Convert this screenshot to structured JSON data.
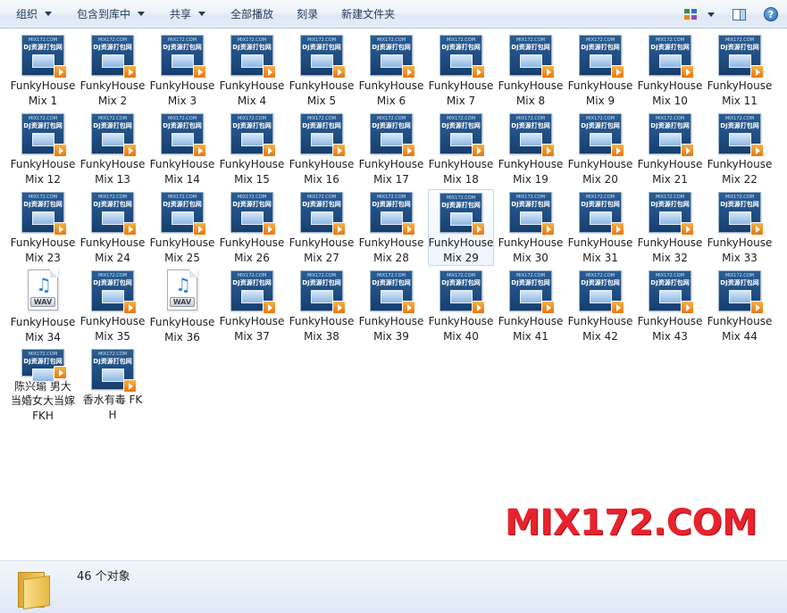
{
  "toolbar": {
    "organize": "组织",
    "include_in_library": "包含到库中",
    "share": "共享",
    "play_all": "全部播放",
    "burn": "刻录",
    "new_folder": "新建文件夹",
    "help": "?"
  },
  "thumbnail": {
    "site": "MIX172.COM",
    "caption": "DJ资源打包网"
  },
  "files": [
    {
      "name": "FunkyHouse Mix 1",
      "type": "video"
    },
    {
      "name": "FunkyHouse Mix 2",
      "type": "video"
    },
    {
      "name": "FunkyHouse Mix 3",
      "type": "video"
    },
    {
      "name": "FunkyHouse Mix 4",
      "type": "video"
    },
    {
      "name": "FunkyHouse Mix 5",
      "type": "video"
    },
    {
      "name": "FunkyHouse Mix 6",
      "type": "video"
    },
    {
      "name": "FunkyHouse Mix 7",
      "type": "video"
    },
    {
      "name": "FunkyHouse Mix 8",
      "type": "video"
    },
    {
      "name": "FunkyHouse Mix 9",
      "type": "video"
    },
    {
      "name": "FunkyHouse Mix 10",
      "type": "video"
    },
    {
      "name": "FunkyHouse Mix 11",
      "type": "video"
    },
    {
      "name": "FunkyHouse Mix 12",
      "type": "video"
    },
    {
      "name": "FunkyHouse Mix 13",
      "type": "video"
    },
    {
      "name": "FunkyHouse Mix 14",
      "type": "video"
    },
    {
      "name": "FunkyHouse Mix 15",
      "type": "video"
    },
    {
      "name": "FunkyHouse Mix 16",
      "type": "video"
    },
    {
      "name": "FunkyHouse Mix 17",
      "type": "video"
    },
    {
      "name": "FunkyHouse Mix 18",
      "type": "video"
    },
    {
      "name": "FunkyHouse Mix 19",
      "type": "video"
    },
    {
      "name": "FunkyHouse Mix 20",
      "type": "video"
    },
    {
      "name": "FunkyHouse Mix 21",
      "type": "video"
    },
    {
      "name": "FunkyHouse Mix 22",
      "type": "video"
    },
    {
      "name": "FunkyHouse Mix 23",
      "type": "video"
    },
    {
      "name": "FunkyHouse Mix 24",
      "type": "video"
    },
    {
      "name": "FunkyHouse Mix 25",
      "type": "video"
    },
    {
      "name": "FunkyHouse Mix 26",
      "type": "video"
    },
    {
      "name": "FunkyHouse Mix 27",
      "type": "video"
    },
    {
      "name": "FunkyHouse Mix 28",
      "type": "video"
    },
    {
      "name": "FunkyHouse Mix 29",
      "type": "video",
      "selected": true
    },
    {
      "name": "FunkyHouse Mix 30",
      "type": "video"
    },
    {
      "name": "FunkyHouse Mix 31",
      "type": "video"
    },
    {
      "name": "FunkyHouse Mix 32",
      "type": "video"
    },
    {
      "name": "FunkyHouse Mix 33",
      "type": "video"
    },
    {
      "name": "FunkyHouse Mix 34",
      "type": "wav"
    },
    {
      "name": "FunkyHouse Mix 35",
      "type": "video"
    },
    {
      "name": "FunkyHouse Mix 36",
      "type": "wav"
    },
    {
      "name": "FunkyHouse Mix 37",
      "type": "video"
    },
    {
      "name": "FunkyHouse Mix 38",
      "type": "video"
    },
    {
      "name": "FunkyHouse Mix 39",
      "type": "video"
    },
    {
      "name": "FunkyHouse Mix 40",
      "type": "video"
    },
    {
      "name": "FunkyHouse Mix 41",
      "type": "video"
    },
    {
      "name": "FunkyHouse Mix 42",
      "type": "video"
    },
    {
      "name": "FunkyHouse Mix 43",
      "type": "video"
    },
    {
      "name": "FunkyHouse Mix 44",
      "type": "video"
    },
    {
      "name": "陈兴瑜 男大当婚女大当嫁 FKH",
      "type": "video"
    },
    {
      "name": "香水有毒 FKH",
      "type": "video"
    }
  ],
  "wav_label": "WAV",
  "watermark": "MIX172.COM",
  "status": {
    "item_count": "46 个对象"
  },
  "colors": {
    "toolbar_text": "#1e395b",
    "watermark": "#e8232e",
    "thumb_bg": "#1f4d82",
    "play_badge": "#f0931f",
    "selection_border": "#c3d9f1"
  }
}
